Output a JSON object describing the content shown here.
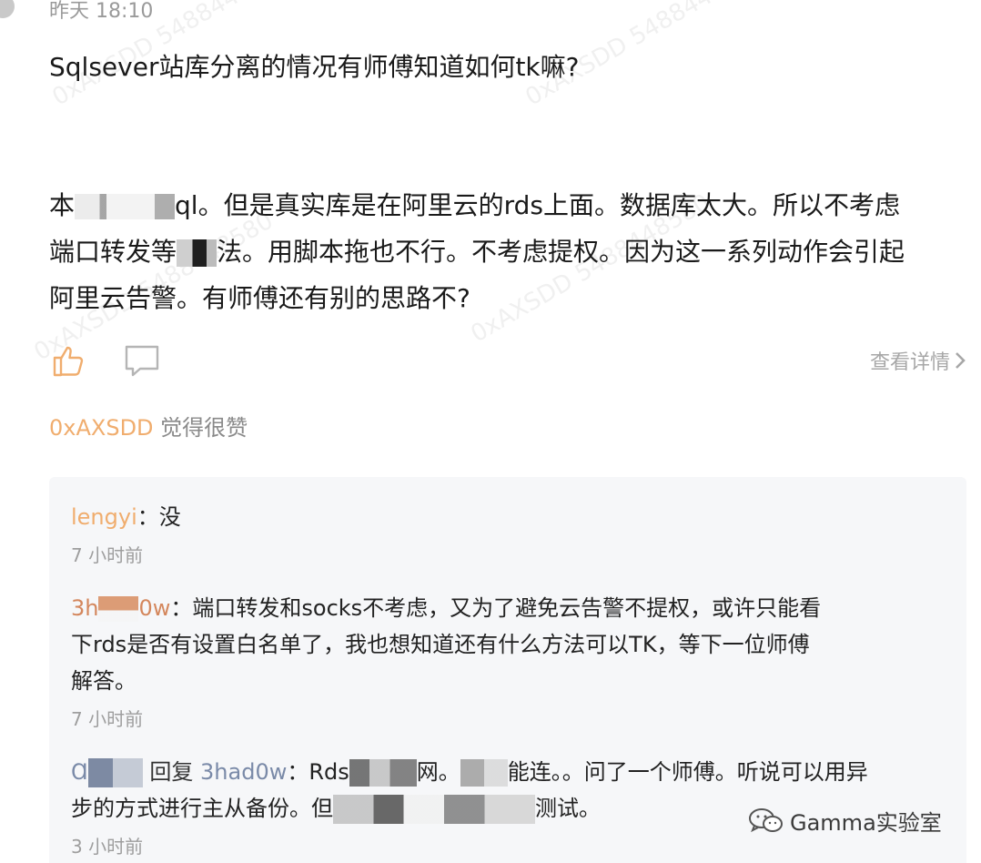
{
  "header": {
    "timestamp": "昨天 18:10"
  },
  "post": {
    "title": "Sqlsever站库分离的情况有师傅知道如何tk嘛?",
    "body_line1_pre": "本",
    "body_line1_mid": "ql。但是真实库是在阿里云的rds上面。数据库太大。所以不考虑",
    "body_line2_pre": "端口转发等",
    "body_line2_post": "法。用脚本拖也不行。不考虑提权。因为这一系列动作会引起",
    "body_line3": "阿里云告警。有师傅还有别的思路不?"
  },
  "actions": {
    "like_icon": "thumbs-up-icon",
    "comment_icon": "speech-bubble-icon",
    "detail_label": "查看详情",
    "detail_icon": "chevron-right-icon"
  },
  "likes": {
    "user": "0xAXSDD",
    "suffix": "觉得很赞"
  },
  "comments": [
    {
      "author": "lengyi",
      "sep": "：",
      "text": "没",
      "time": "7 小时前"
    },
    {
      "author_pre": "3h",
      "author_post": "0w",
      "sep": "：",
      "text_line1": "端口转发和socks不考虑，又为了避免云告警不提权，或许只能看",
      "text_line2": "下rds是否有设置白名单了，我也想知道还有什么方法可以TK，等下一位师傅",
      "text_line3": "解答。",
      "time": "7 小时前"
    },
    {
      "author_pre": "Ɑ",
      "reply_word": "回复",
      "reply_target": "3had0w",
      "sep": "：",
      "text_a": "Rds",
      "text_b": "网。",
      "text_c": "能连。。问了一个师傅。听说可以用异",
      "text_line2_a": "步的方式进行主从备份。但",
      "text_line2_b": "测试。",
      "time": "3 小时前"
    }
  ],
  "brand": {
    "name": "Gamma实验室",
    "icon": "wechat-icon"
  },
  "watermark": {
    "text": "0xAXSDD 5488448580",
    "color": "#a0a0a0"
  },
  "colors": {
    "accent": "#f0ad6e",
    "muted": "#9e9e9e",
    "panel": "#f6f7f9"
  }
}
